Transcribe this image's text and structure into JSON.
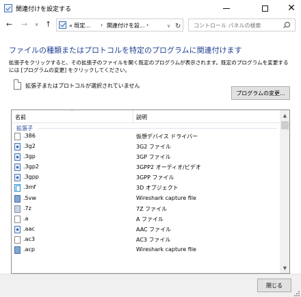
{
  "window": {
    "title": "関連付けを設定する",
    "minimize_icon": "minimize-icon",
    "maximize_icon": "maximize-icon",
    "close_glyph": "✕"
  },
  "address_bar": {
    "back_glyph": "←",
    "forward_glyph": "→",
    "dropdown_glyph": "∨",
    "up_glyph": "↑",
    "crumbs": [
      "«  既定...",
      "›",
      "関連付けを設...",
      "›"
    ],
    "addr_dropdown_glyph": "∨",
    "refresh_glyph": "↻",
    "search_placeholder": "コントロール パネルの検索"
  },
  "main": {
    "heading": "ファイルの種類またはプロトコルを特定のプログラムに関連付けます",
    "description": "拡張子をクリックすると、その拡張子のファイルを開く既定のプログラムが表示されます。既定のプログラムを変更するには [プログラムの変更] をクリックしてください。",
    "selected_status": "拡張子またはプロトコルが選択されていません",
    "change_program_button": "プログラムの変更..."
  },
  "list": {
    "columns": [
      "名前",
      "説明"
    ],
    "sort_glyph": "^",
    "group_label": "拡張子",
    "rows": [
      {
        "ext": ".386",
        "desc": "仮想デバイス ドライバー",
        "icon": "generic-file-icon"
      },
      {
        "ext": ".3g2",
        "desc": "3G2 ファイル",
        "icon": "media-file-icon"
      },
      {
        "ext": ".3gp",
        "desc": "3GP ファイル",
        "icon": "media-file-icon"
      },
      {
        "ext": ".3gp2",
        "desc": "3GPP2 オーディオ/ビデオ",
        "icon": "media-file-icon"
      },
      {
        "ext": ".3gpp",
        "desc": "3GPP ファイル",
        "icon": "media-file-icon"
      },
      {
        "ext": ".3mf",
        "desc": "3D オブジェクト",
        "icon": "3d-object-icon"
      },
      {
        "ext": ".5vw",
        "desc": "Wireshark capture file",
        "icon": "wireshark-file-icon"
      },
      {
        "ext": ".7z",
        "desc": "7Z ファイル",
        "icon": "archive-file-icon"
      },
      {
        "ext": ".a",
        "desc": "A ファイル",
        "icon": "generic-file-icon"
      },
      {
        "ext": ".aac",
        "desc": "AAC ファイル",
        "icon": "media-file-icon"
      },
      {
        "ext": ".ac3",
        "desc": "AC3 ファイル",
        "icon": "generic-file-icon"
      },
      {
        "ext": ".acp",
        "desc": "Wireshark capture file",
        "icon": "wireshark-file-icon"
      }
    ],
    "scroll_up_glyph": "▲",
    "scroll_down_glyph": "▼"
  },
  "footer": {
    "close_button": "閉じる"
  }
}
